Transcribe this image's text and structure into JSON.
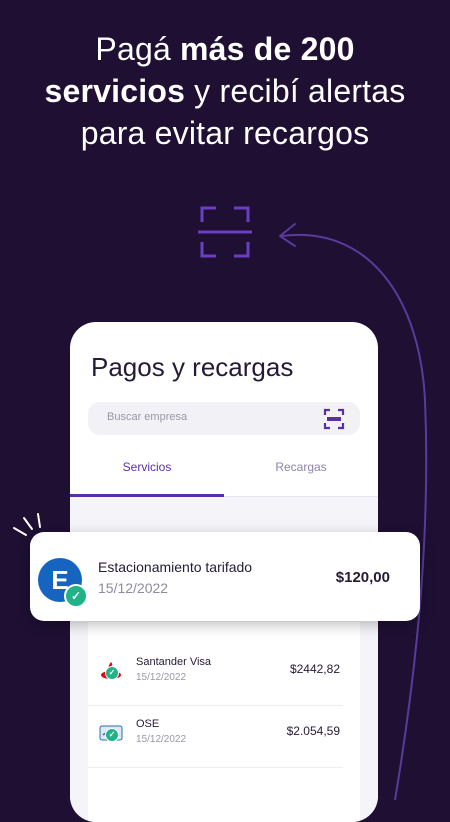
{
  "headline": {
    "part1": "Pagá ",
    "bold1": "más de 200",
    "bold2": "servicios",
    "part2": " y recibí alertas",
    "line3": "para evitar recargos"
  },
  "phone": {
    "title": "Pagos y recargas",
    "search_placeholder": "Buscar empresa",
    "tabs": [
      {
        "label": "Servicios",
        "active": true
      },
      {
        "label": "Recargas",
        "active": false
      }
    ]
  },
  "highlight": {
    "logo_letter": "E",
    "name": "Estacionamiento tarifado",
    "date": "15/12/2022",
    "amount": "$120,00"
  },
  "payments": [
    {
      "name": "Santander Visa",
      "date": "15/12/2022",
      "amount": "$2442,82",
      "icon": "santander-flame-icon"
    },
    {
      "name": "OSE",
      "date": "15/12/2022",
      "amount": "$2.054,59",
      "icon": "ose-logo-icon"
    }
  ],
  "colors": {
    "background": "#1e0f33",
    "accent": "#5a2ea6",
    "success": "#1fb387",
    "brand_blue": "#1565c0",
    "santander_red": "#e30613"
  }
}
